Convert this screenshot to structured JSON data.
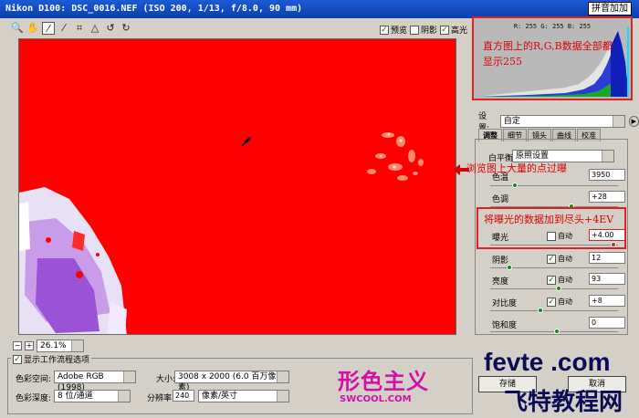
{
  "window": {
    "title": "Nikon D100:  DSC_0016.NEF  (ISO 200, 1/13, f/8.0, 90 mm)",
    "title_stamp": "拼音加加"
  },
  "toolbar": {
    "tools": [
      {
        "icon": "zoom-icon",
        "glyph": "🔍"
      },
      {
        "icon": "hand-icon",
        "glyph": "✋"
      },
      {
        "icon": "eyedropper-icon",
        "glyph": "⁄"
      },
      {
        "icon": "color-sampler-icon",
        "glyph": "⁄"
      },
      {
        "icon": "crop-icon",
        "glyph": "⌗"
      },
      {
        "icon": "straighten-icon",
        "glyph": "△"
      },
      {
        "icon": "rotate-left-icon",
        "glyph": "↺"
      },
      {
        "icon": "rotate-right-icon",
        "glyph": "↻"
      }
    ],
    "preview_label": "预览",
    "shadows_label": "阴影",
    "highlights_label": "高光"
  },
  "histogram": {
    "rgb_readout": "R: 255  G: 255  B: 255",
    "note": "直方图上的R,G,B数据全部都显示255"
  },
  "settings": {
    "label": "设置:",
    "value": "自定"
  },
  "tabs": [
    "调整",
    "细节",
    "镜头",
    "曲线",
    "校准"
  ],
  "adjust": {
    "white_balance_label": "白平衡:",
    "white_balance_value": "原照设置",
    "temperature_label": "色温",
    "temperature_value": "3950",
    "tint_label": "色调",
    "tint_value": "+28",
    "exposure_label": "曝光",
    "exposure_value": "+4.00",
    "shadows_label": "阴影",
    "shadows_value": "12",
    "brightness_label": "亮度",
    "brightness_value": "93",
    "contrast_label": "对比度",
    "contrast_value": "+8",
    "saturation_label": "饱和度",
    "saturation_value": "0",
    "auto_label": "自动"
  },
  "annotations": {
    "preview_callout": "浏览图上大量的点过曝",
    "exposure_note": "将曝光的数据加到尽头+4EV"
  },
  "zoom": {
    "value": "26.1%"
  },
  "workflow": {
    "title": "显示工作流程选项",
    "colorspace_label": "色彩空间:",
    "colorspace_value": "Adobe RGB (1998)",
    "depth_label": "色彩深度:",
    "depth_value": "8 位/通道",
    "size_label": "大小:",
    "size_value": "3008 x 2000  (6.0 百万像素)",
    "resolution_label": "分辨率:",
    "resolution_value": "240",
    "resolution_unit": "像素/英寸"
  },
  "buttons": {
    "ok": "存储",
    "cancel": "取消"
  },
  "watermarks": {
    "swcool_cn": "形色主义",
    "swcool": "SWCOOL.COM",
    "fevte": "fevte .com",
    "fevte_cn": "飞特教程网"
  },
  "colors": {
    "overexposed": "#ff0000",
    "annotation": "#dd0000",
    "watermark": "#d20ea7"
  }
}
